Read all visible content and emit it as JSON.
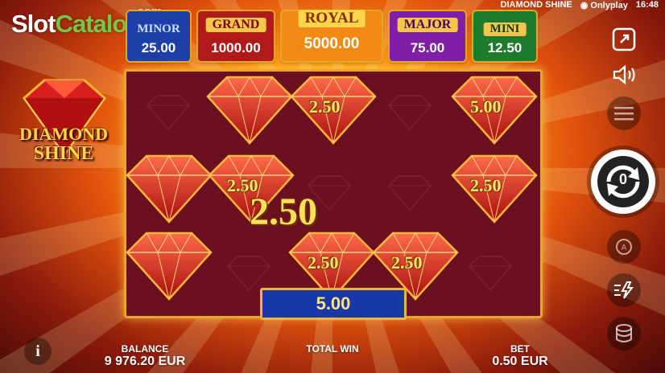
{
  "watermark": {
    "part1": "Slot",
    "part2": "Catalog",
    "part3": ".com"
  },
  "header": {
    "game_title": "DIAMOND SHINE",
    "provider": "Onlyplay",
    "time": "16:48"
  },
  "jackpots": [
    {
      "label": "MINOR",
      "value": "25.00",
      "color": "#1d3fa8"
    },
    {
      "label": "GRAND",
      "value": "1000.00",
      "color": "#b01a1a"
    },
    {
      "label": "ROYAL",
      "value": "5000.00",
      "color": "#f28a14"
    },
    {
      "label": "MAJOR",
      "value": "75.00",
      "color": "#7f1fa8"
    },
    {
      "label": "MINI",
      "value": "12.50",
      "color": "#1e7a2c"
    }
  ],
  "logo": {
    "line1": "DIAMOND",
    "line2": "SHINE"
  },
  "gem_values": [
    "2.50",
    "5.00",
    "2.50",
    "2.50",
    "2.50",
    "2.50"
  ],
  "total_win_popup": "2.50",
  "win_box": "5.00",
  "spin": {
    "count": "0"
  },
  "footer": {
    "balance_label": "BALANCE",
    "balance_value": "9 976.20 EUR",
    "total_win_label": "TOTAL WIN",
    "bet_label": "BET",
    "bet_value": "0.50 EUR"
  },
  "icons": [
    "fullscreen-icon",
    "sound-icon",
    "menu-icon",
    "spin-icon",
    "autoplay-icon",
    "turbo-icon",
    "coins-icon",
    "info-icon"
  ]
}
